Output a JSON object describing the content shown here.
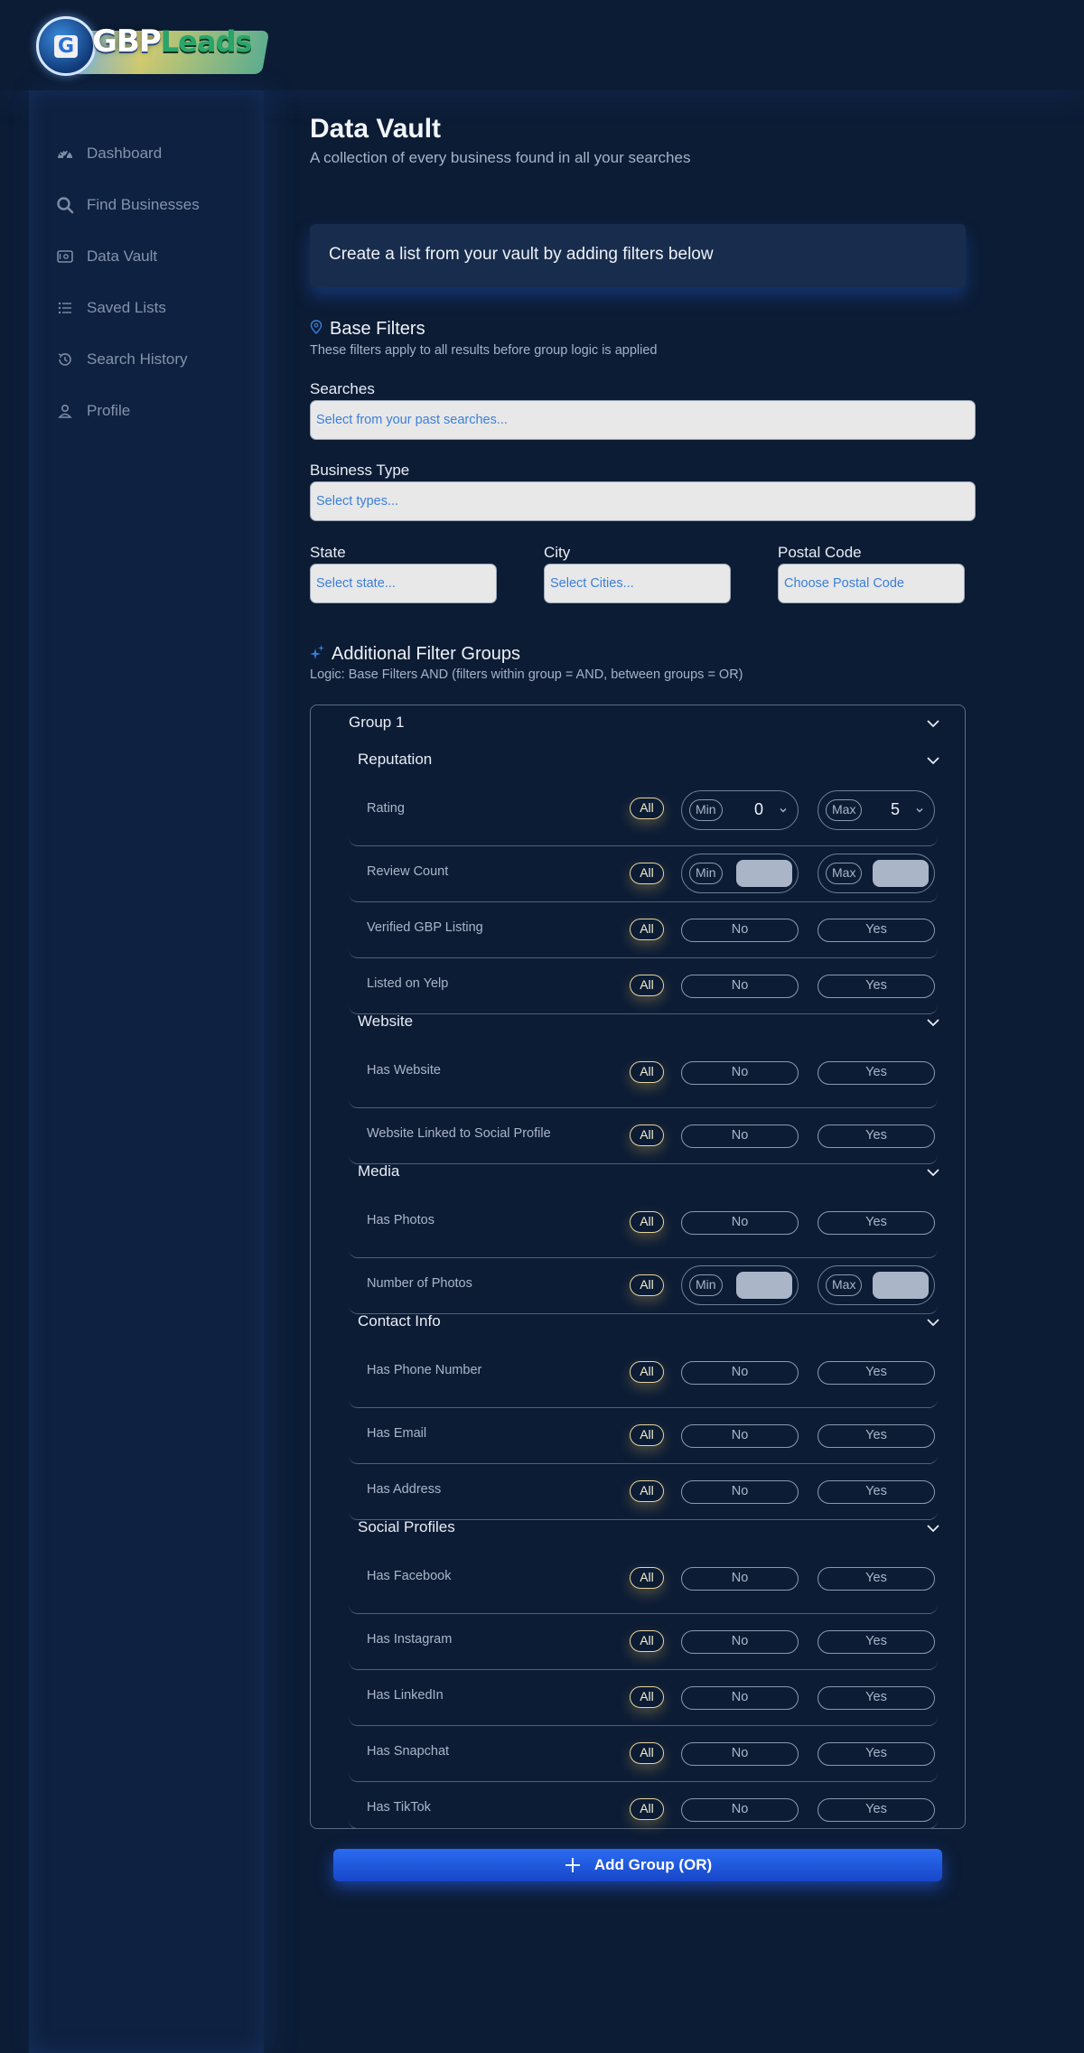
{
  "brand": {
    "logo_badge_letter": "G",
    "logo_text_1": "GBP",
    "logo_text_2": "Leads"
  },
  "sidebar": {
    "items": [
      {
        "label": "Dashboard",
        "icon": "dashboard-gauge-icon"
      },
      {
        "label": "Find Businesses",
        "icon": "search-icon"
      },
      {
        "label": "Data Vault",
        "icon": "vault-icon"
      },
      {
        "label": "Saved Lists",
        "icon": "list-icon"
      },
      {
        "label": "Search History",
        "icon": "history-icon"
      },
      {
        "label": "Profile",
        "icon": "user-icon"
      }
    ]
  },
  "page": {
    "title": "Data Vault",
    "subtitle": "A collection of every business found in all your searches",
    "banner": "Create a list from your vault by adding filters below"
  },
  "base_filters": {
    "title": "Base Filters",
    "description": "These filters apply to all results before group logic is applied",
    "searches_label": "Searches",
    "searches_placeholder": "Select from your past searches...",
    "business_type_label": "Business Type",
    "business_type_placeholder": "Select types...",
    "state_label": "State",
    "state_placeholder": "Select state...",
    "city_label": "City",
    "city_placeholder": "Select Cities...",
    "postal_label": "Postal Code",
    "postal_placeholder": "Choose Postal Code"
  },
  "additional": {
    "title": "Additional Filter Groups",
    "logic": "Logic: Base Filters AND (filters within group = AND, between groups = OR)"
  },
  "group": {
    "title": "Group 1",
    "all_label": "All",
    "no_label": "No",
    "yes_label": "Yes",
    "min_label": "Min",
    "max_label": "Max",
    "categories": {
      "reputation": "Reputation",
      "website": "Website",
      "media": "Media",
      "contact": "Contact Info",
      "social": "Social Profiles"
    },
    "rating": {
      "label": "Rating",
      "min": "0",
      "max": "5"
    },
    "review_count": "Review Count",
    "verified": "Verified GBP Listing",
    "yelp": "Listed on Yelp",
    "has_website": "Has Website",
    "website_social": "Website Linked to Social Profile",
    "has_photos": "Has Photos",
    "num_photos": "Number of Photos",
    "has_phone": "Has Phone Number",
    "has_email": "Has Email",
    "has_address": "Has Address",
    "has_facebook": "Has Facebook",
    "has_instagram": "Has Instagram",
    "has_linkedin": "Has LinkedIn",
    "has_snapchat": "Has Snapchat",
    "has_tiktok": "Has TikTok"
  },
  "actions": {
    "add_group": "Add Group (OR)"
  },
  "colors": {
    "background": "#0c1c35",
    "sidebar": "#0f2140",
    "accent_blue": "#2a6cf0",
    "all_pill": "#e8d59a",
    "field_text": "#3b7fd8"
  }
}
